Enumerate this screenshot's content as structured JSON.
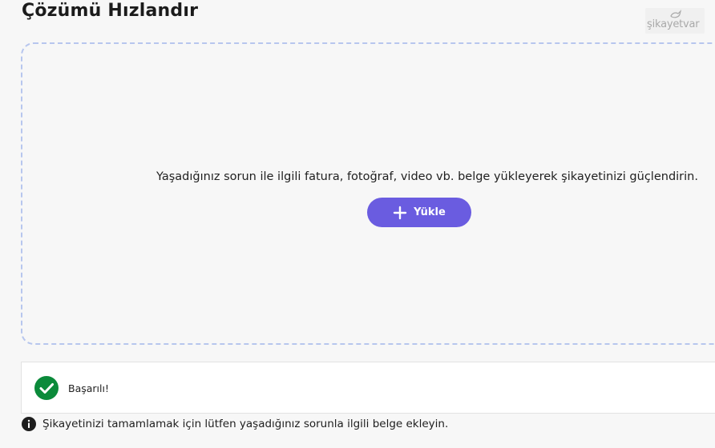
{
  "header": {
    "title": "Çözümü Hızlandır"
  },
  "watermark": {
    "text": "şikayetvar"
  },
  "dropzone": {
    "description": "Yaşadığınız sorun ile ilgili fatura, fotoğraf, video vb. belge yükleyerek şikayetinizi güçlendirin.",
    "upload_label": "Yükle",
    "icon": "plus-icon"
  },
  "status": {
    "success_text": "Başarılı!",
    "icon": "check-circle-icon",
    "color": "#0b8a3a"
  },
  "info": {
    "text": "Şikayetinizi tamamlamak için lütfen yaşadığınız sorunla ilgili belge ekleyin.",
    "icon": "info-icon"
  },
  "colors": {
    "accent": "#6a5ce0",
    "dashed_border": "#b7c6ee"
  }
}
